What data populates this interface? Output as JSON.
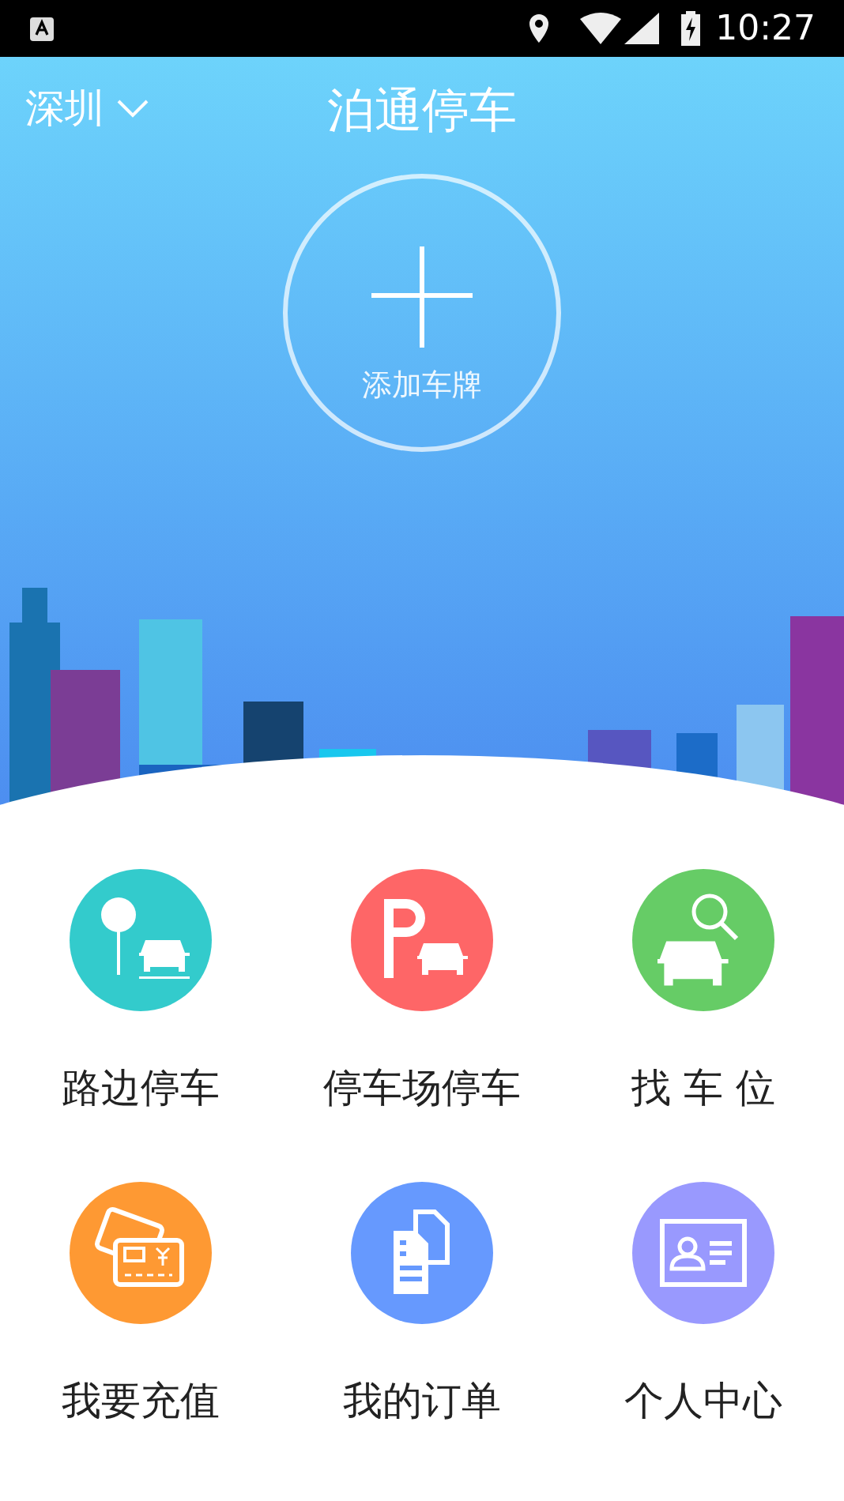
{
  "status_bar": {
    "time": "10:27"
  },
  "header": {
    "city": "深圳",
    "title": "泊通停车"
  },
  "add_plate": {
    "label": "添加车牌"
  },
  "menu": [
    {
      "label": "路边停车",
      "kind": "street",
      "color": "#33cbcc"
    },
    {
      "label": "停车场停车",
      "kind": "lot",
      "color": "#fe6667"
    },
    {
      "label": "找 车 位",
      "kind": "find",
      "color": "#66cc66"
    },
    {
      "label": "我要充值",
      "kind": "recharge",
      "color": "#fe9933"
    },
    {
      "label": "我的订单",
      "kind": "orders",
      "color": "#6699fe"
    },
    {
      "label": "个人中心",
      "kind": "profile",
      "color": "#9999fe"
    }
  ]
}
